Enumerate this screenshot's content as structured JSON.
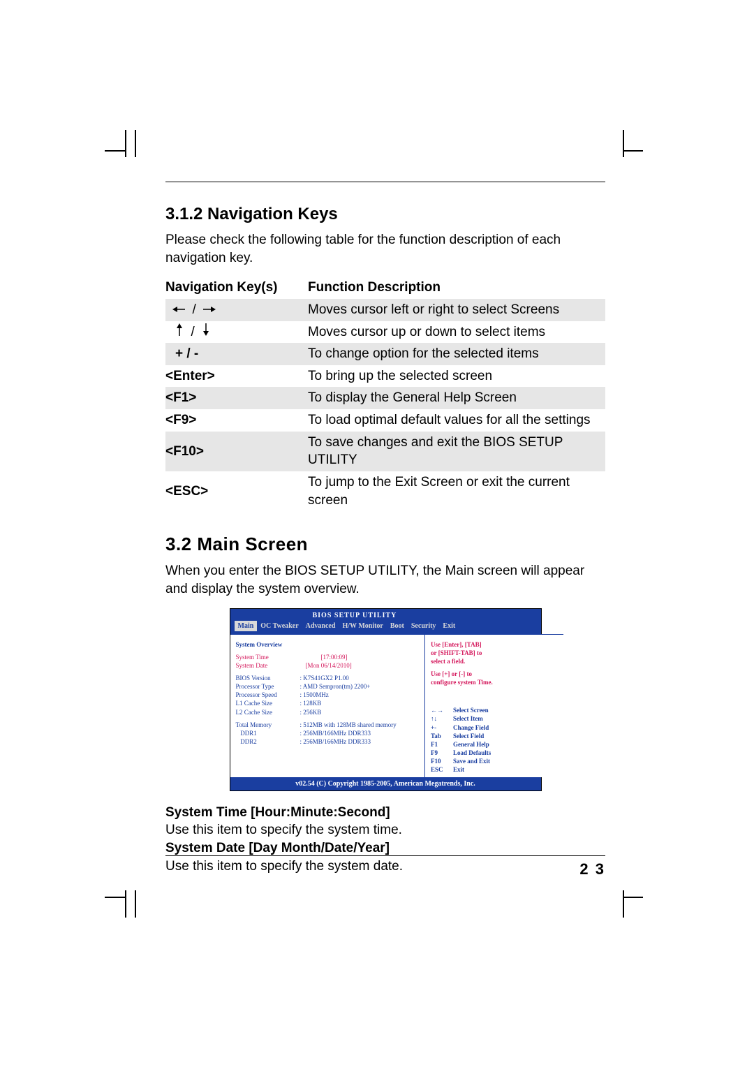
{
  "section312": {
    "title": "3.1.2 Navigation Keys",
    "intro": "Please check the following table for the function description of each navigation key.",
    "th_key": "Navigation Key(s)",
    "th_desc": "Function Description",
    "rows": [
      {
        "key_html": "← / →",
        "desc": "Moves cursor left or right to select Screens"
      },
      {
        "key_html": "↑ / ↓",
        "desc": "Moves cursor up or down to select items"
      },
      {
        "key_html": "+ / -",
        "desc": "To change option for the selected items"
      },
      {
        "key_html": "<Enter>",
        "desc": "To bring up the selected screen"
      },
      {
        "key_html": "<F1>",
        "desc": "To display the General Help Screen"
      },
      {
        "key_html": "<F9>",
        "desc": "To load optimal default values for all the settings"
      },
      {
        "key_html": "<F10>",
        "desc": "To save changes and exit the BIOS SETUP UTILITY"
      },
      {
        "key_html": "<ESC>",
        "desc": "To jump to the Exit Screen or exit the current screen"
      }
    ]
  },
  "section32": {
    "title": "3.2    Main Screen",
    "intro": "When you enter the BIOS SETUP UTILITY, the Main screen will appear and display the system overview."
  },
  "bios": {
    "title": "BIOS SETUP UTILITY",
    "tabs": [
      "Main",
      "OC Tweaker",
      "Advanced",
      "H/W Monitor",
      "Boot",
      "Security",
      "Exit"
    ],
    "left": {
      "heading": "System Overview",
      "sys_time_lbl": "System Time",
      "sys_time_val": "[17:00:09]",
      "sys_date_lbl": "System Date",
      "sys_date_val": "[Mon 06/14/2010]",
      "lines": [
        {
          "lbl": "BIOS Version",
          "val": ": K7S41GX2 P1.00"
        },
        {
          "lbl": "Processor Type",
          "val": ": AMD Sempron(tm) 2200+"
        },
        {
          "lbl": "Processor Speed",
          "val": ": 1500MHz"
        },
        {
          "lbl": "L1 Cache Size",
          "val": ": 128KB"
        },
        {
          "lbl": "L2 Cache Size",
          "val": ": 256KB"
        }
      ],
      "mem": [
        {
          "lbl": "Total Memory",
          "val": ": 512MB with 128MB shared memory"
        },
        {
          "lbl": "   DDR1",
          "val": ": 256MB/166MHz DDR333"
        },
        {
          "lbl": "   DDR2",
          "val": ": 256MB/166MHz DDR333"
        }
      ]
    },
    "right": {
      "hint1": "Use [Enter], [TAB]",
      "hint2": "or [SHIFT-TAB] to",
      "hint3": "select a field.",
      "hint4": "Use [+] or [-] to",
      "hint5": "configure system Time.",
      "keys": [
        {
          "k": "←→",
          "d": "Select Screen"
        },
        {
          "k": "↑↓",
          "d": "Select Item"
        },
        {
          "k": "+-",
          "d": "Change Field"
        },
        {
          "k": "Tab",
          "d": "Select Field"
        },
        {
          "k": "F1",
          "d": "General Help"
        },
        {
          "k": "F9",
          "d": "Load Defaults"
        },
        {
          "k": "F10",
          "d": "Save and Exit"
        },
        {
          "k": "ESC",
          "d": "Exit"
        }
      ]
    },
    "footer": "v02.54 (C) Copyright 1985-2005, American Megatrends, Inc."
  },
  "below_bios": {
    "item1_title": "System Time [Hour:Minute:Second]",
    "item1_desc": "Use this item to specify the system time.",
    "item2_title": "System Date [Day Month/Date/Year]",
    "item2_desc": "Use this item to specify the system date."
  },
  "page_number": "2 3"
}
